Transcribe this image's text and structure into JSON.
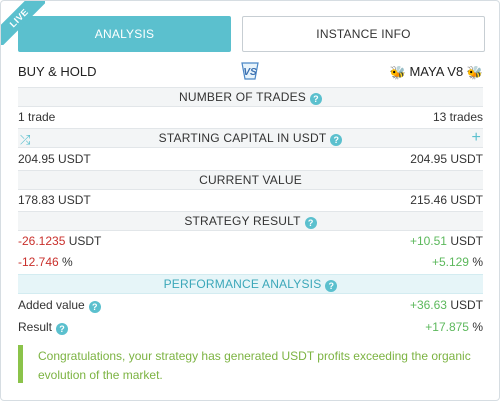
{
  "ribbon": {
    "label": "LIVE"
  },
  "tabs": {
    "analysis": "ANALYSIS",
    "instance_info": "INSTANCE INFO"
  },
  "header": {
    "left": "BUY & HOLD",
    "center_logo": "VS",
    "right": "MAYA V8"
  },
  "sections": {
    "trades": {
      "title": "NUMBER OF TRADES",
      "left": "1 trade",
      "right": "13 trades"
    },
    "capital": {
      "title": "STARTING CAPITAL IN USDT",
      "left": "204.95 USDT",
      "right": "204.95 USDT"
    },
    "current": {
      "title": "CURRENT VALUE",
      "left": "178.83 USDT",
      "right": "215.46 USDT"
    },
    "result": {
      "title": "STRATEGY RESULT",
      "left_usdt": "-26.1235",
      "left_usdt_unit": "USDT",
      "right_usdt": "+10.51",
      "right_usdt_unit": "USDT",
      "left_pct": "-12.746",
      "left_pct_unit": "%",
      "right_pct": "+5.129",
      "right_pct_unit": "%"
    },
    "performance": {
      "title": "PERFORMANCE ANALYSIS",
      "added_label": "Added value",
      "added_value": "+36.63",
      "added_unit": "USDT",
      "result_label": "Result",
      "result_value": "+17.875",
      "result_unit": "%"
    }
  },
  "message": "Congratulations, your strategy has generated USDT profits exceeding the organic evolution of the market.",
  "icons": {
    "help": "?",
    "shuffle": "⤮",
    "plus": "+",
    "bee": "🐝"
  },
  "colors": {
    "accent": "#5bc0ce",
    "negative": "#c9302c",
    "positive": "#5cb85c",
    "message": "#7cb342"
  }
}
